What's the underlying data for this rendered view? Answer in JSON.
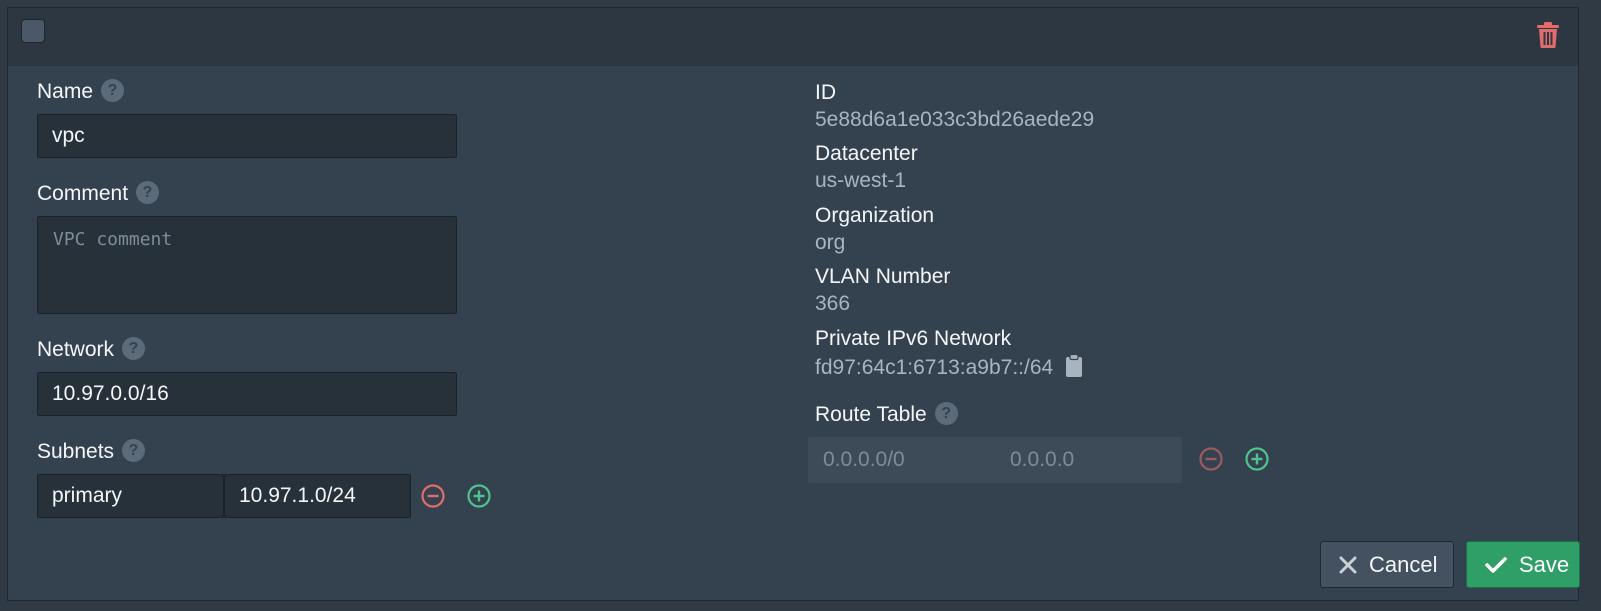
{
  "header": {
    "select_icon": "checkbox-icon",
    "delete_icon": "trash-icon"
  },
  "form": {
    "name": {
      "label": "Name",
      "value": "vpc"
    },
    "comment": {
      "label": "Comment",
      "placeholder": "VPC comment"
    },
    "network": {
      "label": "Network",
      "value": "10.97.0.0/16"
    },
    "subnets": {
      "label": "Subnets",
      "rows": [
        {
          "name": "primary",
          "network": "10.97.1.0/24"
        }
      ]
    }
  },
  "details": {
    "id": {
      "label": "ID",
      "value": "5e88d6a1e033c3bd26aede29"
    },
    "datacenter": {
      "label": "Datacenter",
      "value": "us-west-1"
    },
    "organization": {
      "label": "Organization",
      "value": "org"
    },
    "vlan": {
      "label": "VLAN Number",
      "value": "366"
    },
    "ipv6": {
      "label": "Private IPv6 Network",
      "value": "fd97:64c1:6713:a9b7::/64",
      "copy_icon": "clipboard-icon"
    }
  },
  "route_table": {
    "label": "Route Table",
    "destination_placeholder": "0.0.0.0/0",
    "target_placeholder": "0.0.0.0"
  },
  "actions": {
    "cancel_label": "Cancel",
    "save_label": "Save"
  },
  "colors": {
    "remove": "#e06c6c",
    "add": "#4fc48a",
    "save_bg": "#2f9e67",
    "panel_bg": "#344250"
  }
}
